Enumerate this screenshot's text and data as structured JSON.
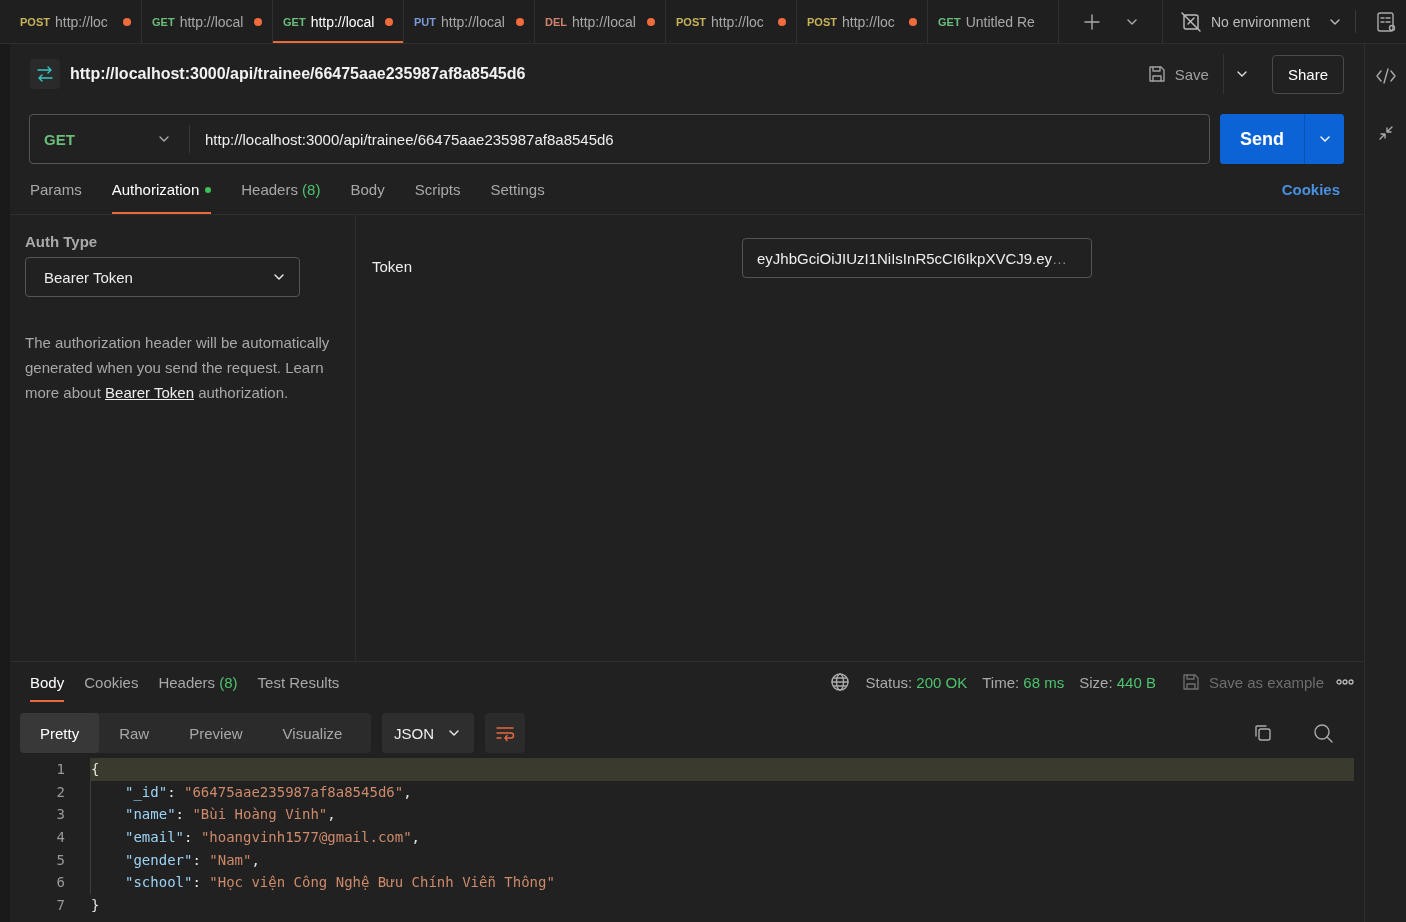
{
  "open_tabs": [
    {
      "method": "POST",
      "label": "http://loc",
      "unsaved": true,
      "selected": false
    },
    {
      "method": "GET",
      "label": "http://local",
      "unsaved": true,
      "selected": false
    },
    {
      "method": "GET",
      "label": "http://local",
      "unsaved": true,
      "selected": true
    },
    {
      "method": "PUT",
      "label": "http://local",
      "unsaved": true,
      "selected": false
    },
    {
      "method": "DEL",
      "label": "http://local",
      "unsaved": true,
      "selected": false
    },
    {
      "method": "POST",
      "label": "http://loc",
      "unsaved": true,
      "selected": false
    },
    {
      "method": "POST",
      "label": "http://loc",
      "unsaved": true,
      "selected": false
    },
    {
      "method": "GET",
      "label": "Untitled Re",
      "unsaved": false,
      "selected": false
    }
  ],
  "environment": {
    "label": "No environment"
  },
  "request": {
    "title": "http://localhost:3000/api/trainee/66475aae235987af8a8545d6",
    "save_label": "Save",
    "share_label": "Share",
    "method": "GET",
    "url": "http://localhost:3000/api/trainee/66475aae235987af8a8545d6",
    "send_label": "Send"
  },
  "request_tabs": [
    {
      "label": "Params",
      "selected": false,
      "indicator": false
    },
    {
      "label": "Authorization",
      "selected": true,
      "indicator": true
    },
    {
      "label": "Headers",
      "count": "(8)",
      "selected": false,
      "indicator": false
    },
    {
      "label": "Body",
      "selected": false,
      "indicator": false
    },
    {
      "label": "Scripts",
      "selected": false,
      "indicator": false
    },
    {
      "label": "Settings",
      "selected": false,
      "indicator": false
    }
  ],
  "cookies_link": "Cookies",
  "auth": {
    "type_label": "Auth Type",
    "type": "Bearer Token",
    "description": "The authorization header will be automatically generated when you send the request. Learn more about ",
    "link": "Bearer Token",
    "description_end": " authorization.",
    "token_label": "Token",
    "token": "eyJhbGciOiJIUzI1NiIsInR5cCI6IkpXVCJ9.ey",
    "token_more": "…"
  },
  "response": {
    "tabs": [
      {
        "label": "Body",
        "selected": true
      },
      {
        "label": "Cookies",
        "selected": false
      },
      {
        "label": "Headers",
        "count": "(8)",
        "selected": false
      },
      {
        "label": "Test Results",
        "selected": false
      }
    ],
    "status_label": "Status:",
    "status": "200 OK",
    "time_label": "Time:",
    "time": "68 ms",
    "size_label": "Size:",
    "size": "440 B",
    "save_example": "Save as example",
    "save_example_disabled": true,
    "view_modes": [
      {
        "label": "Pretty",
        "selected": true
      },
      {
        "label": "Raw",
        "selected": false
      },
      {
        "label": "Preview",
        "selected": false
      },
      {
        "label": "Visualize",
        "selected": false
      }
    ],
    "format": "JSON",
    "lines": [
      {
        "number": "1",
        "highlighted": true,
        "tokens": [
          {
            "kind": "punct",
            "text": "{"
          }
        ],
        "children": [
          {
            "number": "2",
            "highlighted": false,
            "tokens": [
              {
                "kind": "key",
                "text": "\"_id\""
              },
              {
                "kind": "punct",
                "text": ": "
              },
              {
                "kind": "string",
                "text": "\"66475aae235987af8a8545d6\""
              },
              {
                "kind": "punct",
                "text": ","
              }
            ]
          },
          {
            "number": "3",
            "highlighted": false,
            "tokens": [
              {
                "kind": "key",
                "text": "\"name\""
              },
              {
                "kind": "punct",
                "text": ": "
              },
              {
                "kind": "string",
                "text": "\"Bùi Hoàng Vinh\""
              },
              {
                "kind": "punct",
                "text": ","
              }
            ]
          },
          {
            "number": "4",
            "highlighted": false,
            "tokens": [
              {
                "kind": "key",
                "text": "\"email\""
              },
              {
                "kind": "punct",
                "text": ": "
              },
              {
                "kind": "string",
                "text": "\"hoangvinh1577@gmail.com\""
              },
              {
                "kind": "punct",
                "text": ","
              }
            ]
          },
          {
            "number": "5",
            "highlighted": false,
            "tokens": [
              {
                "kind": "key",
                "text": "\"gender\""
              },
              {
                "kind": "punct",
                "text": ": "
              },
              {
                "kind": "string",
                "text": "\"Nam\""
              },
              {
                "kind": "punct",
                "text": ","
              }
            ]
          },
          {
            "number": "6",
            "highlighted": false,
            "tokens": [
              {
                "kind": "key",
                "text": "\"school\""
              },
              {
                "kind": "punct",
                "text": ": "
              },
              {
                "kind": "string",
                "text": "\"Học viện Công Nghệ Bưu Chính Viễn Thông\""
              }
            ]
          }
        ]
      },
      {
        "number": "7",
        "highlighted": false,
        "tokens": [
          {
            "kind": "punct",
            "text": "}"
          }
        ]
      }
    ]
  }
}
